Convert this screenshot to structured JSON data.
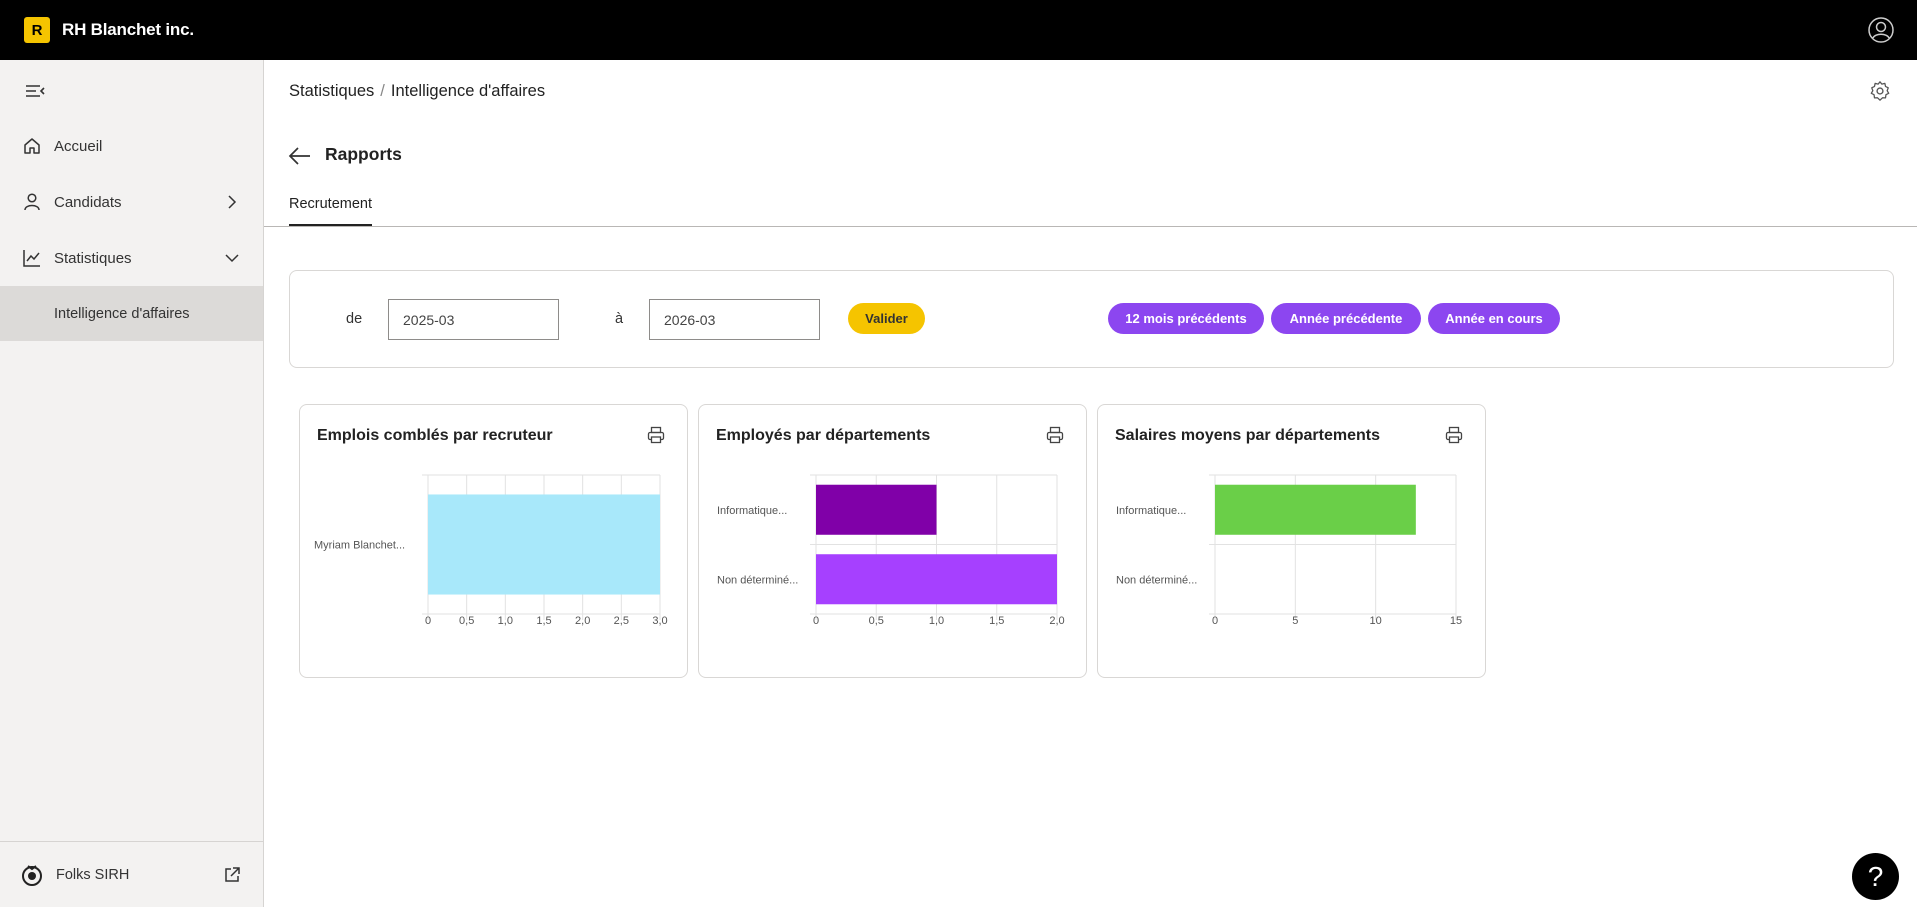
{
  "app": {
    "logo_letter": "R",
    "title": "RH Blanchet inc."
  },
  "sidebar": {
    "items": [
      {
        "label": "Accueil"
      },
      {
        "label": "Candidats"
      },
      {
        "label": "Statistiques"
      }
    ],
    "sub_item": "Intelligence d'affaires",
    "footer_label": "Folks SIRH"
  },
  "header": {
    "breadcrumb": [
      "Statistiques",
      "Intelligence d'affaires"
    ],
    "breadcrumb_sep": "/",
    "title": "Rapports",
    "tab": "Recrutement"
  },
  "filters": {
    "from_label": "de",
    "from_value": "2025-03",
    "to_label": "à",
    "to_value": "2026-03",
    "validate_label": "Valider",
    "presets": [
      "12 mois précédents",
      "Année précédente",
      "Année en cours"
    ]
  },
  "colors": {
    "accent_yellow": "#f5c400",
    "accent_purple": "#8c46f0"
  },
  "chart_data": [
    {
      "type": "bar",
      "orientation": "horizontal",
      "title": "Emplois comblés par recruteur",
      "categories": [
        "Myriam Blanchet..."
      ],
      "values": [
        3
      ],
      "xlim": [
        0,
        3
      ],
      "ticks": [
        "0",
        "0,5",
        "1,0",
        "1,5",
        "2,0",
        "2,5",
        "3,0"
      ],
      "colors": [
        "#a8e8fa"
      ],
      "grid": true
    },
    {
      "type": "bar",
      "orientation": "horizontal",
      "title": "Employés par départements",
      "categories": [
        "Informatique...",
        "Non déterminé..."
      ],
      "values": [
        1,
        2
      ],
      "xlim": [
        0,
        2
      ],
      "ticks": [
        "0",
        "0,5",
        "1,0",
        "1,5",
        "2,0"
      ],
      "colors": [
        "#8000a8",
        "#a640ff"
      ],
      "grid": true
    },
    {
      "type": "bar",
      "orientation": "horizontal",
      "title": "Salaires moyens par départements",
      "categories": [
        "Informatique...",
        "Non déterminé..."
      ],
      "values": [
        12.5,
        0
      ],
      "xlim": [
        0,
        15
      ],
      "ticks": [
        "0",
        "5",
        "10",
        "15"
      ],
      "colors": [
        "#6acf48",
        "#6acf48"
      ],
      "grid": true
    }
  ],
  "help_label": "?"
}
